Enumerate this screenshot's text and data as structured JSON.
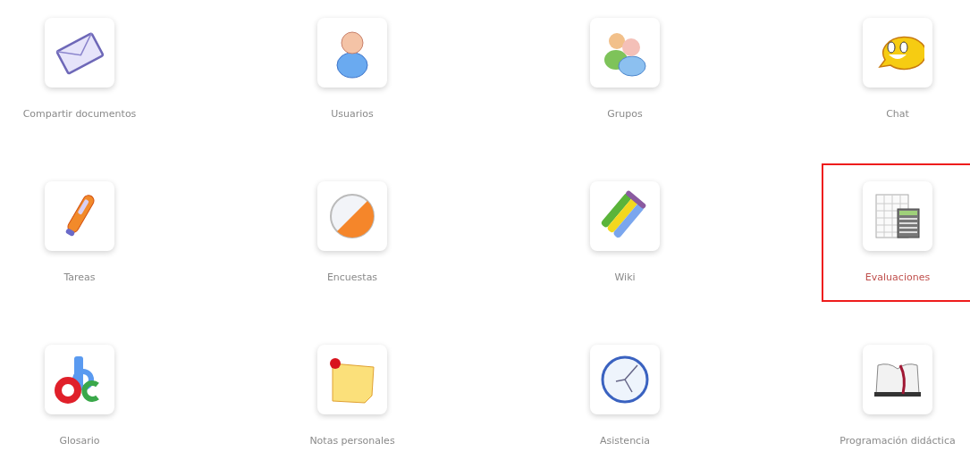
{
  "tools": [
    {
      "label": "Compartir documentos",
      "selected": false
    },
    {
      "label": "Usuarios",
      "selected": false
    },
    {
      "label": "Grupos",
      "selected": false
    },
    {
      "label": "Chat",
      "selected": false
    },
    {
      "label": "Tareas",
      "selected": false
    },
    {
      "label": "Encuestas",
      "selected": false
    },
    {
      "label": "Wiki",
      "selected": false
    },
    {
      "label": "Evaluaciones",
      "selected": true
    },
    {
      "label": "Glosario",
      "selected": false
    },
    {
      "label": "Notas personales",
      "selected": false
    },
    {
      "label": "Asistencia",
      "selected": false
    },
    {
      "label": "Programación didáctica",
      "selected": false
    }
  ]
}
